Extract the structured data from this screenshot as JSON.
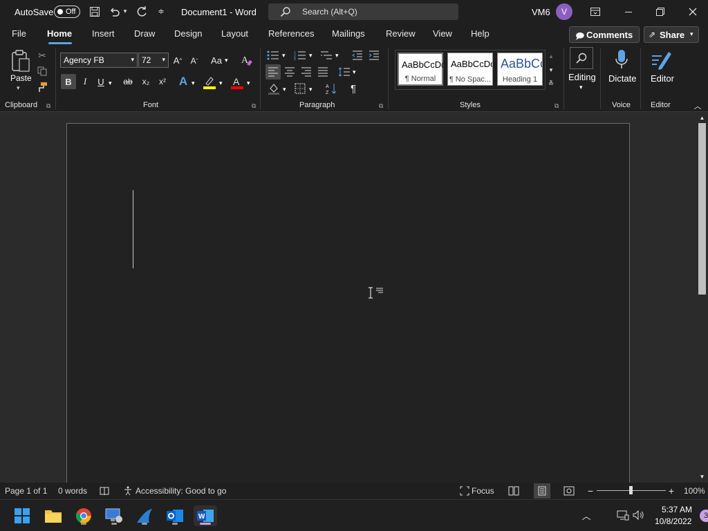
{
  "titlebar": {
    "autosave_label": "AutoSave",
    "autosave_state": "Off",
    "doc_title": "Document1  -  Word",
    "search_placeholder": "Search (Alt+Q)",
    "user_name": "VM6",
    "avatar_initial": "V"
  },
  "tabs": [
    "File",
    "Home",
    "Insert",
    "Draw",
    "Design",
    "Layout",
    "References",
    "Mailings",
    "Review",
    "View",
    "Help"
  ],
  "active_tab": "Home",
  "comments_label": "Comments",
  "share_label": "Share",
  "clipboard": {
    "paste_label": "Paste",
    "group_label": "Clipboard"
  },
  "font": {
    "name": "Agency FB",
    "size": "72",
    "group_label": "Font",
    "bold": "B",
    "italic": "I",
    "underline": "U",
    "strike": "ab",
    "subscript": "x₂",
    "superscript": "x²",
    "grow": "A^",
    "shrink": "Aˇ",
    "case": "Aa"
  },
  "paragraph": {
    "group_label": "Paragraph"
  },
  "styles": {
    "group_label": "Styles",
    "items": [
      {
        "preview": "AaBbCcDc",
        "label": "¶ Normal"
      },
      {
        "preview": "AaBbCcDc",
        "label": "¶ No Spac..."
      },
      {
        "preview": "AaBbCc",
        "label": "Heading 1"
      }
    ]
  },
  "editing": {
    "label": "Editing"
  },
  "voice": {
    "dictate_label": "Dictate",
    "group_label": "Voice"
  },
  "editor": {
    "label": "Editor",
    "group_label": "Editor"
  },
  "status": {
    "page": "Page 1 of 1",
    "words": "0 words",
    "accessibility": "Accessibility: Good to go",
    "focus": "Focus",
    "zoom": "100%"
  },
  "taskbar": {
    "time": "5:37 AM",
    "date": "10/8/2022",
    "notif_count": "3"
  },
  "colors": {
    "highlight": "#ffff00",
    "font_color": "#ff0000",
    "accent": "#5ea3e6",
    "avatar": "#8b5fbf"
  }
}
